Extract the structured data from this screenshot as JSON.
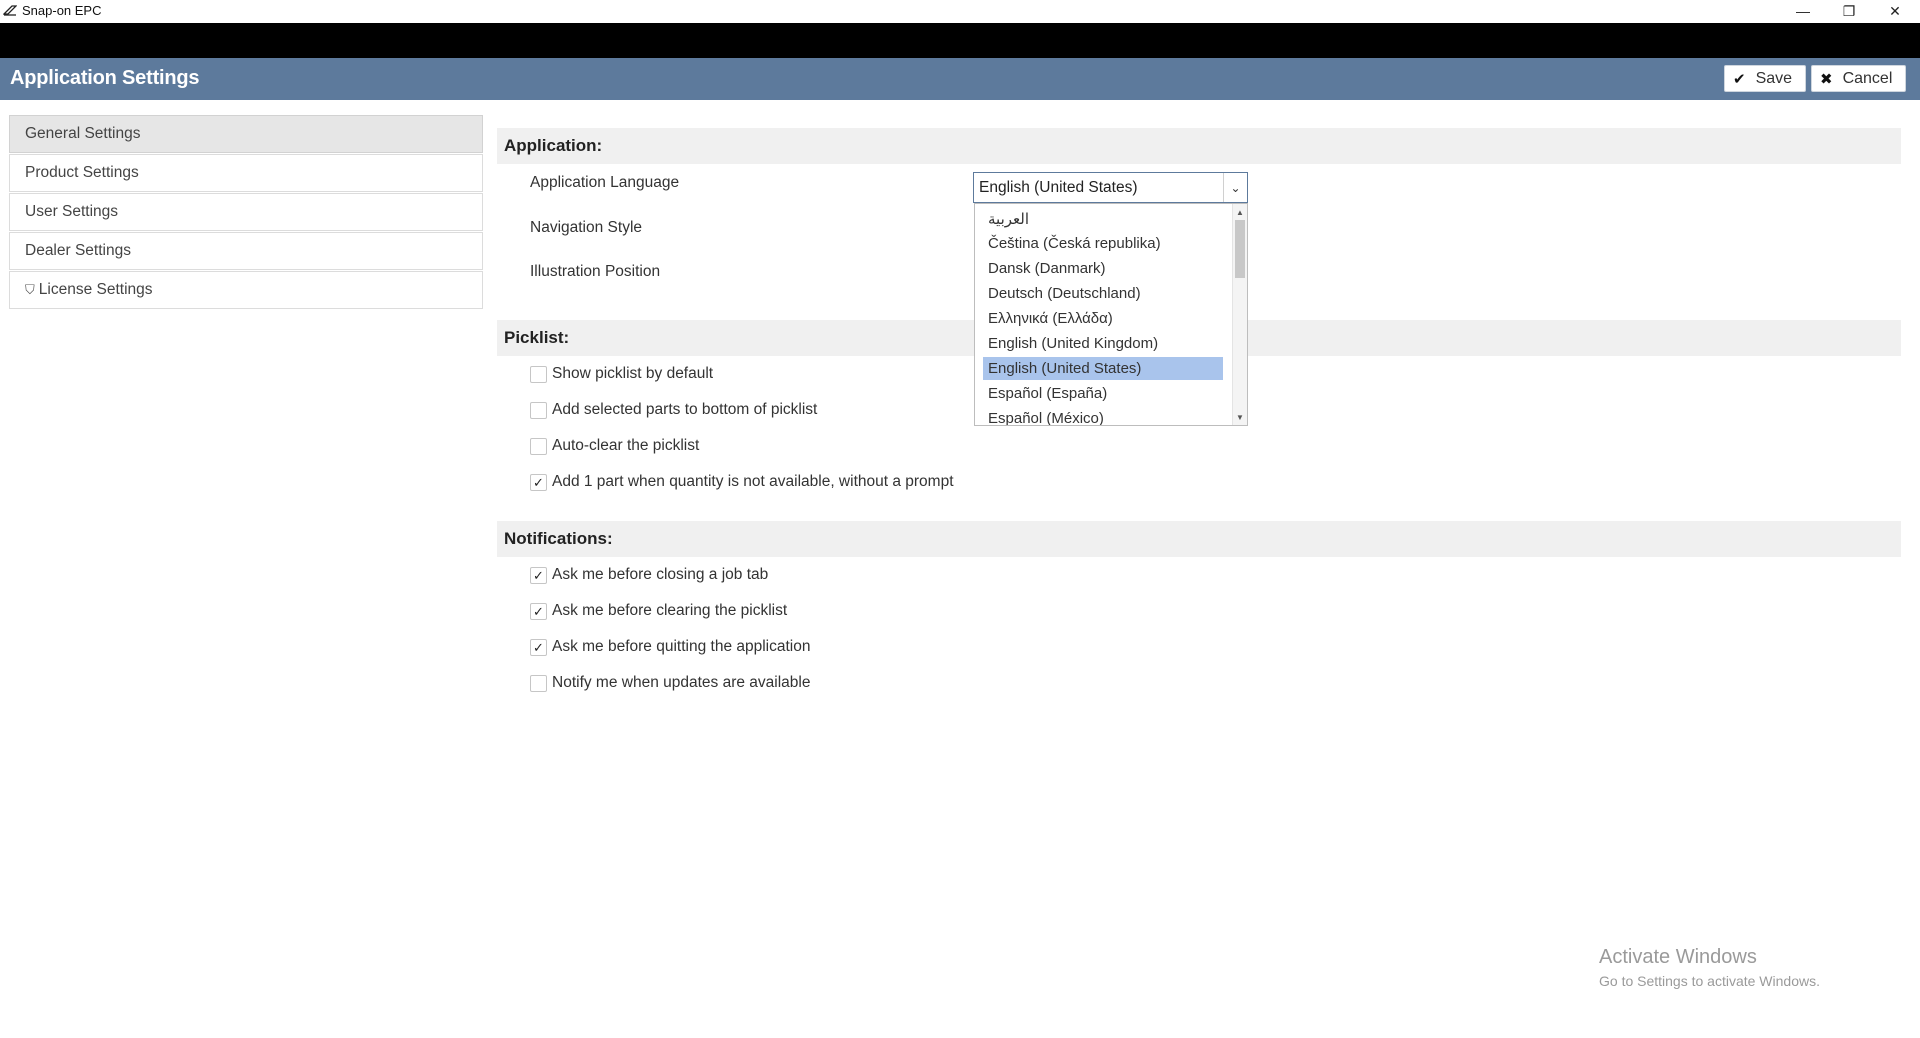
{
  "window": {
    "title": "Snap-on EPC",
    "minimize_glyph": "—",
    "restore_glyph": "❐",
    "close_glyph": "✕"
  },
  "header": {
    "title": "Application Settings",
    "save_label": "Save",
    "cancel_label": "Cancel",
    "brand_color": "#5d7a9c"
  },
  "sidebar": {
    "items": [
      {
        "label": "General Settings",
        "active": true
      },
      {
        "label": "Product Settings"
      },
      {
        "label": "User Settings"
      },
      {
        "label": "Dealer Settings"
      },
      {
        "label": "License Settings",
        "icon": "shield-icon"
      }
    ]
  },
  "application": {
    "heading": "Application:",
    "language_label": "Application Language",
    "language_value": "English (United States)",
    "navigation_label": "Navigation Style",
    "illustration_label": "Illustration Position",
    "language_options": [
      "العربية",
      "Čeština (Česká republika)",
      "Dansk (Danmark)",
      "Deutsch (Deutschland)",
      "Ελληνικά (Ελλάδα)",
      "English (United Kingdom)",
      "English (United States)",
      "Español (España)",
      "Español (México)"
    ],
    "selected_option_index": 6
  },
  "picklist": {
    "heading": "Picklist:",
    "options": [
      {
        "label": "Show picklist by default",
        "checked": false
      },
      {
        "label": "Add selected parts to bottom of picklist",
        "checked": false
      },
      {
        "label": "Auto-clear the picklist",
        "checked": false
      },
      {
        "label": "Add 1 part when quantity is not available, without a prompt",
        "checked": true
      }
    ]
  },
  "notifications": {
    "heading": "Notifications:",
    "options": [
      {
        "label": "Ask me before closing a job tab",
        "checked": true
      },
      {
        "label": "Ask me before clearing the picklist",
        "checked": true
      },
      {
        "label": "Ask me before quitting the application",
        "checked": true
      },
      {
        "label": "Notify me when updates are available",
        "checked": false
      }
    ]
  },
  "watermark": {
    "line1": "Activate Windows",
    "line2": "Go to Settings to activate Windows."
  }
}
